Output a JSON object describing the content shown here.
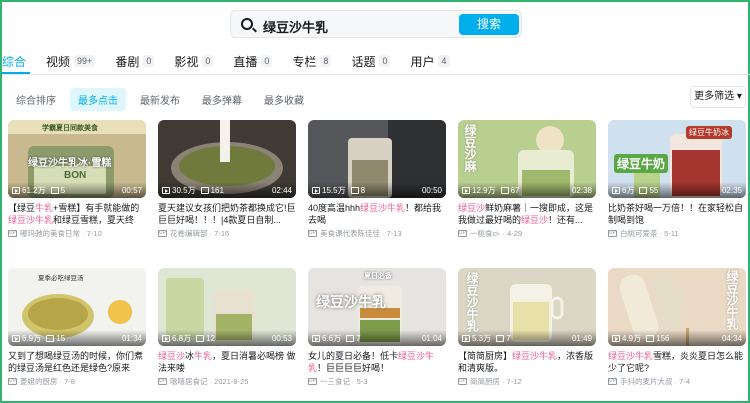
{
  "search": {
    "query": "绿豆沙牛乳",
    "button_label": "搜索"
  },
  "tabs": [
    {
      "label": "综合",
      "count": ""
    },
    {
      "label": "视频",
      "count": "99+"
    },
    {
      "label": "番剧",
      "count": "0"
    },
    {
      "label": "影视",
      "count": "0"
    },
    {
      "label": "直播",
      "count": "0"
    },
    {
      "label": "专栏",
      "count": "8"
    },
    {
      "label": "话题",
      "count": "0"
    },
    {
      "label": "用户",
      "count": "4"
    }
  ],
  "sort": {
    "options": [
      "综合排序",
      "最多点击",
      "最新发布",
      "最多弹幕",
      "最多收藏"
    ],
    "more_filter": "更多筛选"
  },
  "colors": {
    "accent": "#00aeec",
    "highlight": "#f25d8e",
    "border": "#2fb56f"
  },
  "videos": [
    {
      "views": "61.2万",
      "danmaku": "5",
      "duration": "00:57",
      "title_parts": [
        "【绿豆",
        "牛乳",
        "+雪糕】有手就能做的",
        "绿豆沙牛乳",
        "和绿豆雪糕，夏天终于..."
      ],
      "author": "嘟玛驰的美食日常",
      "date": "7-10",
      "thumb_caption_1": "学霸夏日同款美食",
      "thumb_caption_2": "绿豆沙牛乳冰·雪糕",
      "thumb_caption_3": "BON"
    },
    {
      "views": "30.5万",
      "danmaku": "161",
      "duration": "02:44",
      "title_parts": [
        "夏天建议女孩们把奶茶都换成它!巨巨巨好喝！！！|4款夏日自制..."
      ],
      "author": "花卷编辑部",
      "date": "7-16"
    },
    {
      "views": "15.5万",
      "danmaku": "8",
      "duration": "00:50",
      "title_parts": [
        "40度高温hhh",
        "绿豆沙牛乳",
        "！都给我去喝"
      ],
      "author": "美食课代表陈佳佳",
      "date": "7-13"
    },
    {
      "views": "12.9万",
      "danmaku": "67",
      "duration": "02:38",
      "title_parts": [
        "绿豆沙",
        "鲜奶麻薯｜一搜即成，这是我做过最好喝的",
        "绿豆沙",
        "！还有..."
      ],
      "author": "一桃食ci-",
      "date": "4-29",
      "thumb_caption_1": "绿豆沙麻"
    },
    {
      "views": "6万",
      "danmaku": "55",
      "duration": "02:35",
      "title_parts": [
        "比奶茶好喝一万倍！！在家轻松自制喝到饱"
      ],
      "author": "白桃可爱茶",
      "date": "5-11",
      "thumb_caption_1": "绿豆牛奶冰",
      "thumb_caption_2": "绿豆牛奶"
    },
    {
      "views": "6.9万",
      "danmaku": "15",
      "duration": "01:34",
      "title_parts": [
        "又到了想喝绿豆汤的时候，你们煮的绿豆汤是红色还是绿色?原来绿..."
      ],
      "author": "菱姐的厨房",
      "date": "7-8",
      "thumb_caption_1": "夏季必吃绿豆汤"
    },
    {
      "views": "6.8万",
      "danmaku": "12",
      "duration": "00:53",
      "title_parts": [
        "绿豆沙",
        "冰",
        "牛乳",
        "，夏日消暑必喝榜  做法来喽"
      ],
      "author": "嘻嘻居食记",
      "date": "2021-8-25"
    },
    {
      "views": "6.6万",
      "danmaku": "7",
      "duration": "01:04",
      "title_parts": [
        "女儿的夏日必备！低卡",
        "绿豆沙牛乳",
        "！巨巨巨巨好喝！"
      ],
      "author": "一三食记",
      "date": "5-3",
      "thumb_caption_1": "夏日必备",
      "thumb_caption_2": "绿豆沙牛乳"
    },
    {
      "views": "5.3万",
      "danmaku": "7",
      "duration": "01:49",
      "title_parts": [
        "【简简厨房】",
        "绿豆沙牛乳",
        "，浓香版和清爽版。"
      ],
      "author": "简简厨房",
      "date": "7-12",
      "thumb_caption_1": "绿豆沙牛乳"
    },
    {
      "views": "4.9万",
      "danmaku": "156",
      "duration": "04:34",
      "title_parts": [
        "绿豆沙牛乳",
        "雪糕，炎炎夏日怎么能少了它呢?"
      ],
      "author": "手抖的麦片大叔",
      "date": "7-4",
      "thumb_caption_1": "绿豆沙牛乳"
    }
  ]
}
